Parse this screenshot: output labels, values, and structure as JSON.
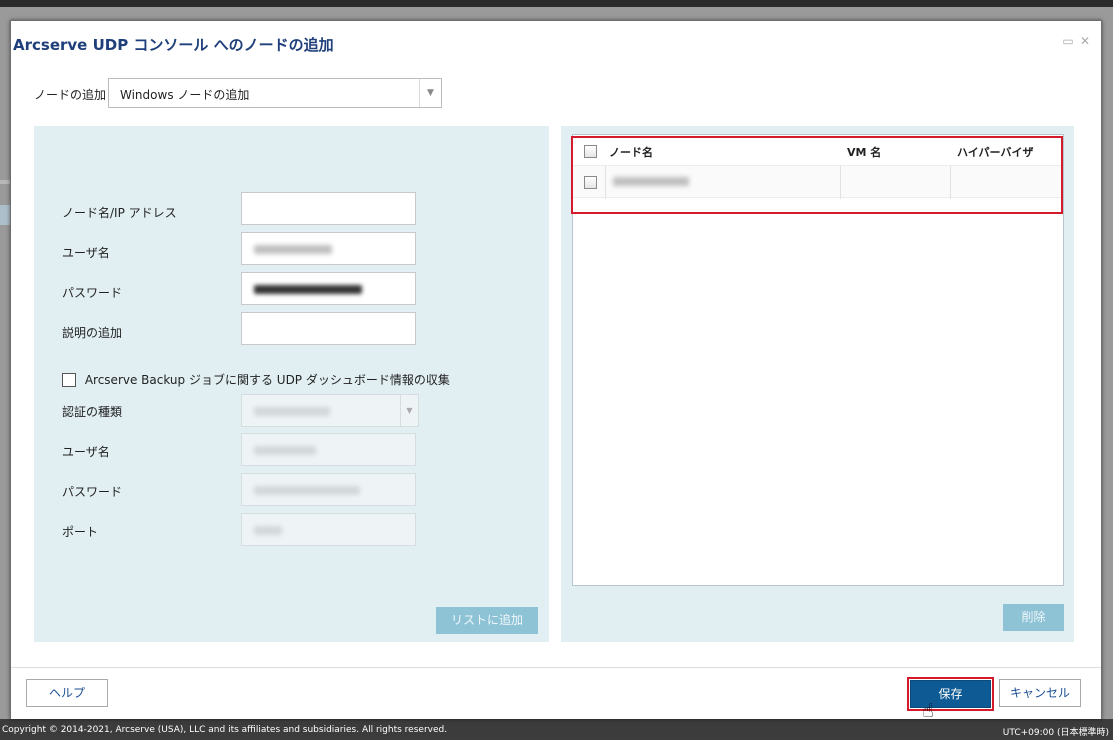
{
  "dialog": {
    "title": "Arcserve UDP コンソール へのノードの追加",
    "restore_icon": "restore-icon",
    "close_icon": "close-icon"
  },
  "add_node": {
    "label": "ノードの追加",
    "selected": "Windows ノードの追加"
  },
  "form": {
    "node_name_label": "ノード名/IP アドレス",
    "node_name_value": "",
    "username_label": "ユーザ名",
    "password_label": "パスワード",
    "description_label": "説明の追加",
    "description_value": "",
    "collect_checkbox_label": "Arcserve Backup ジョブに関する UDP ダッシュボード情報の収集",
    "collect_checked": false,
    "auth_type_label": "認証の種類",
    "backup_username_label": "ユーザ名",
    "backup_password_label": "パスワード",
    "port_label": "ポート",
    "add_to_list_button": "リストに追加"
  },
  "list": {
    "columns": [
      "ノード名",
      "VM 名",
      "ハイパーバイザ"
    ],
    "rows": [
      {
        "node_name": "",
        "vm_name": "",
        "hypervisor": "",
        "checked": false
      }
    ],
    "delete_button": "削除"
  },
  "buttons": {
    "help": "ヘルプ",
    "save": "保存",
    "cancel": "キャンセル"
  },
  "footer": {
    "copyright": "Copyright © 2014-2021, Arcserve (USA), LLC and its affiliates and subsidiaries. All rights reserved.",
    "timezone": "UTC+09:00 (日本標準時)"
  }
}
